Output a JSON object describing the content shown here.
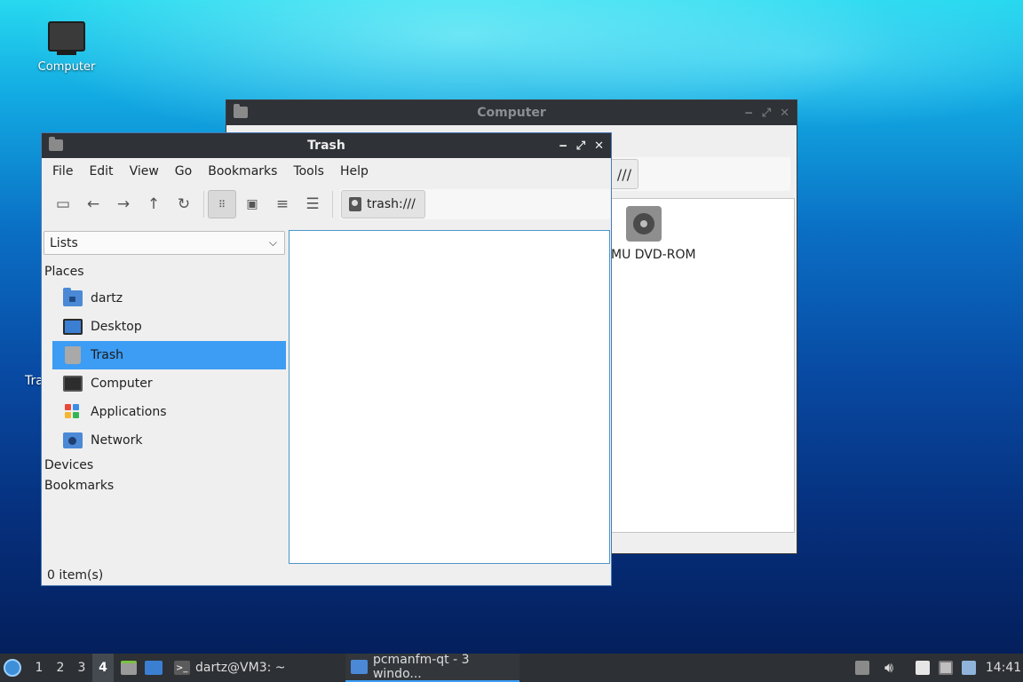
{
  "desktop": {
    "icons": [
      {
        "label": "Computer"
      },
      {
        "label": "Tra"
      }
    ]
  },
  "back_window": {
    "title": "Computer",
    "path_fragment": "///",
    "item_label": "MU DVD-ROM"
  },
  "front_window": {
    "title": "Trash",
    "window_buttons": {
      "minimize": "‒",
      "maximize": "⤢",
      "close": "✕"
    },
    "menu": [
      "File",
      "Edit",
      "View",
      "Go",
      "Bookmarks",
      "Tools",
      "Help"
    ],
    "path": "trash:///",
    "side_pane_mode": "Lists",
    "sections": {
      "places": "Places",
      "devices": "Devices",
      "bookmarks": "Bookmarks"
    },
    "places": [
      {
        "label": "dartz",
        "icon": "home-folder-icon"
      },
      {
        "label": "Desktop",
        "icon": "desktop-icon"
      },
      {
        "label": "Trash",
        "icon": "trash-icon",
        "selected": true
      },
      {
        "label": "Computer",
        "icon": "computer-icon"
      },
      {
        "label": "Applications",
        "icon": "applications-icon"
      },
      {
        "label": "Network",
        "icon": "network-icon"
      }
    ],
    "status": "0 item(s)"
  },
  "taskbar": {
    "workspaces": [
      "1",
      "2",
      "3",
      "4"
    ],
    "current_workspace": "4",
    "tasks": [
      {
        "label": "dartz@VM3: ~"
      },
      {
        "label": "pcmanfm-qt - 3 windo..."
      }
    ],
    "clock": "14:41"
  },
  "colors": {
    "selection": "#3d9cf3",
    "titlebar": "#2f3236",
    "taskbar": "#2d3034"
  }
}
